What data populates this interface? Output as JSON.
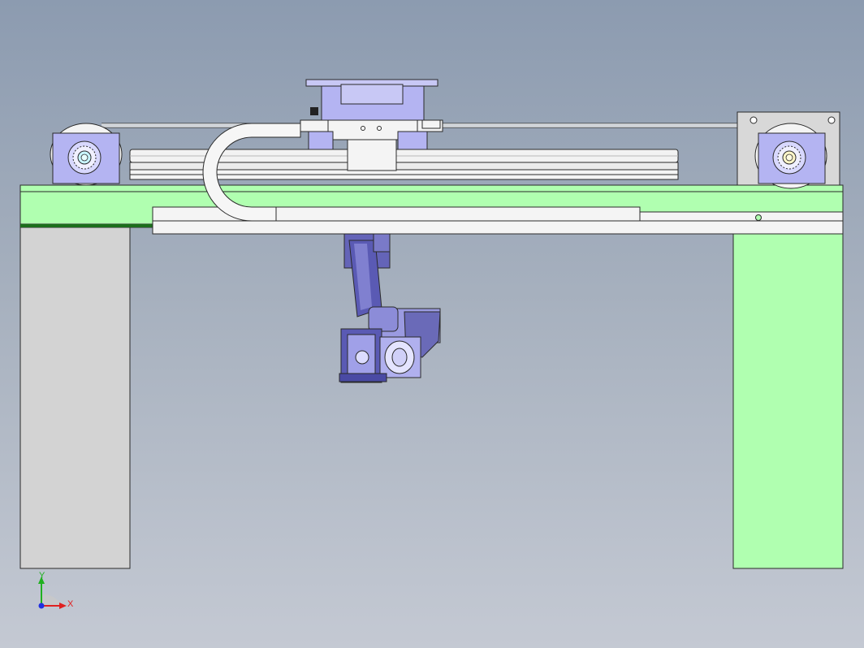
{
  "viewport": {
    "background_top": "#8c9bb0",
    "background_bottom": "#c4c9d3"
  },
  "colors": {
    "green_part": "#b0ffb0",
    "grey_part": "#d3d3d3",
    "purple_part": "#b4b4f2",
    "dark_purple_part": "#5a5ab4",
    "white_part": "#f4f4f4",
    "edge": "#2a2a2a",
    "light_cyan_bearing": "#c8f5ff",
    "light_yellow_bearing": "#fff6c8"
  },
  "triad": {
    "x_label": "X",
    "y_label": "Y",
    "x_color": "#e02020",
    "y_color": "#20b020",
    "z_color": "#2030e0",
    "icon": "coordinate-triad-icon"
  },
  "model": {
    "parts": [
      "left-support-column",
      "right-support-column",
      "main-beam",
      "linear-rail",
      "cable-carrier",
      "carriage",
      "robot-arm",
      "end-effector",
      "left-pulley",
      "right-pulley",
      "belt"
    ]
  }
}
